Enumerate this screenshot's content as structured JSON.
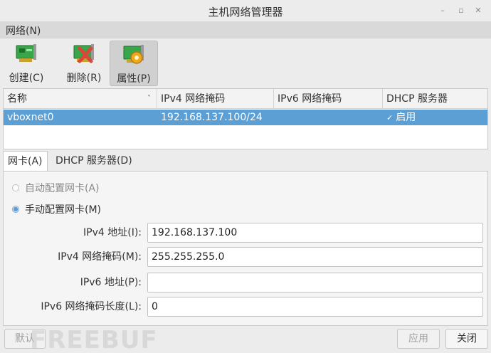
{
  "window": {
    "title": "主机网络管理器",
    "controls": [
      "–",
      "▫",
      "✕"
    ]
  },
  "menubar": {
    "network": "网络(N)"
  },
  "toolbar": {
    "create": "创建(C)",
    "delete": "删除(R)",
    "properties": "属性(P)"
  },
  "table": {
    "headers": [
      "名称",
      "IPv4 网络掩码",
      "IPv6 网络掩码",
      "DHCP 服务器"
    ],
    "sort_glyph": "˅",
    "rows": [
      {
        "name": "vboxnet0",
        "ipv4": "192.168.137.100/24",
        "ipv6": "",
        "check": "✓",
        "dhcp": "启用"
      }
    ]
  },
  "tabs": {
    "adapter": "网卡(A)",
    "dhcp": "DHCP 服务器(D)"
  },
  "adapter": {
    "auto": "自动配置网卡(A)",
    "manual": "手动配置网卡(M)",
    "ipv4_addr_label": "IPv4 地址(I):",
    "ipv4_addr": "192.168.137.100",
    "ipv4_mask_label": "IPv4 网络掩码(M):",
    "ipv4_mask": "255.255.255.0",
    "ipv6_addr_label": "IPv6 地址(P):",
    "ipv6_addr": "",
    "ipv6_prefix_label": "IPv6 网络掩码长度(L):",
    "ipv6_prefix": "0"
  },
  "buttons": {
    "reset": "默认",
    "apply": "应用",
    "close": "关闭"
  },
  "watermark": "FREEBUF",
  "colors": {
    "selection": "#5b9fd4",
    "nic_green": "#3aa64a",
    "delete_red": "#d9463a",
    "gear_orange": "#f0a81c"
  }
}
